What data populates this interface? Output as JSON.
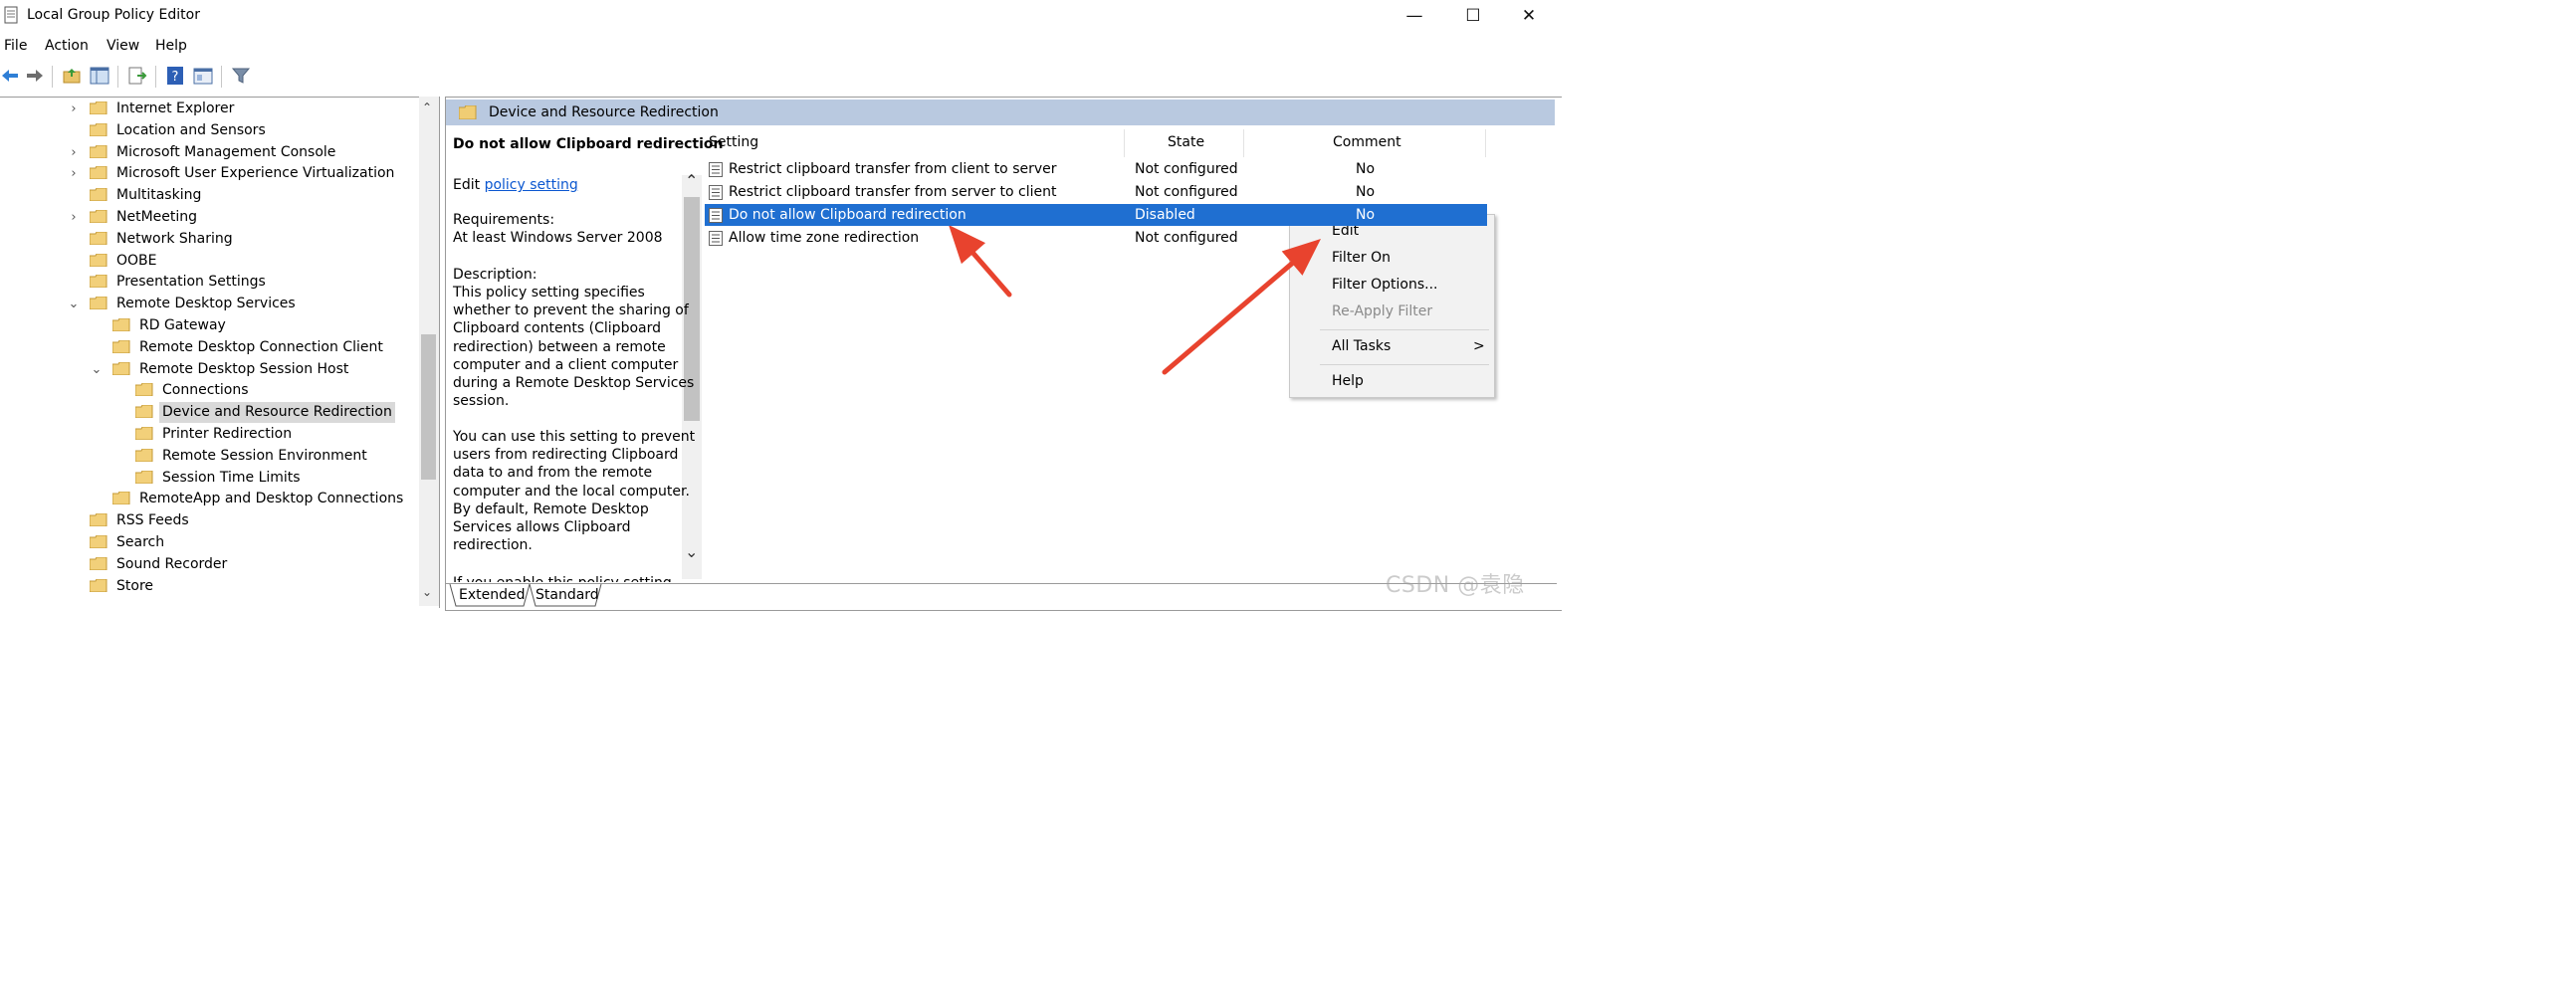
{
  "window": {
    "title": "Local Group Policy Editor",
    "controls": {
      "minimize": "—",
      "maximize": "☐",
      "close": "✕"
    }
  },
  "menu": [
    "File",
    "Action",
    "View",
    "Help"
  ],
  "toolbar": {
    "icons": [
      "back-icon",
      "forward-icon",
      "up-folder-icon",
      "show-hide-tree-icon",
      "export-list-icon",
      "help-icon",
      "properties-icon",
      "filter-icon"
    ]
  },
  "tree": {
    "items": [
      {
        "label": "Internet Explorer",
        "expander": ">"
      },
      {
        "label": "Location and Sensors",
        "expander": ""
      },
      {
        "label": "Microsoft Management Console",
        "expander": ">"
      },
      {
        "label": "Microsoft User Experience Virtualization",
        "expander": ">"
      },
      {
        "label": "Multitasking",
        "expander": ""
      },
      {
        "label": "NetMeeting",
        "expander": ">"
      },
      {
        "label": "Network Sharing",
        "expander": ""
      },
      {
        "label": "OOBE",
        "expander": ""
      },
      {
        "label": "Presentation Settings",
        "expander": ""
      },
      {
        "label": "Remote Desktop Services",
        "expander": "v"
      },
      {
        "label": "RD Gateway",
        "expander": ""
      },
      {
        "label": "Remote Desktop Connection Client",
        "expander": ""
      },
      {
        "label": "Remote Desktop Session Host",
        "expander": "v"
      },
      {
        "label": "Connections",
        "expander": ""
      },
      {
        "label": "Device and Resource Redirection",
        "expander": "",
        "selected": true
      },
      {
        "label": "Printer Redirection",
        "expander": ""
      },
      {
        "label": "Remote Session Environment",
        "expander": ""
      },
      {
        "label": "Session Time Limits",
        "expander": ""
      },
      {
        "label": "RemoteApp and Desktop Connections",
        "expander": ""
      },
      {
        "label": "RSS Feeds",
        "expander": ""
      },
      {
        "label": "Search",
        "expander": ""
      },
      {
        "label": "Sound Recorder",
        "expander": ""
      },
      {
        "label": "Store",
        "expander": ""
      }
    ]
  },
  "pane": {
    "header": "Device and Resource Redirection",
    "desc": {
      "title": "Do not allow Clipboard redirection",
      "edit_prefix": "Edit ",
      "edit_link": "policy setting ",
      "req_label": "Requirements:",
      "req_value": "At least Windows Server 2008",
      "desc_label": "Description:",
      "desc_lines": [
        "This policy setting specifies",
        "whether to prevent the sharing of",
        "Clipboard contents (Clipboard",
        "redirection) between a remote",
        "computer and a client computer",
        "during a Remote Desktop Services",
        "session."
      ],
      "more_lines": [
        "You can use this setting to prevent",
        "users from redirecting Clipboard",
        "data to and from the remote",
        "computer and the local computer.",
        "By default, Remote Desktop",
        "Services allows Clipboard",
        "redirection."
      ],
      "cut_line": "If you enable this policy setting"
    },
    "columns": {
      "setting": "Setting",
      "state": "State",
      "comment": "Comment"
    },
    "rows": [
      {
        "setting": "Restrict clipboard transfer from client to server",
        "state": "Not configured",
        "comment": "No"
      },
      {
        "setting": "Restrict clipboard transfer from server to client",
        "state": "Not configured",
        "comment": "No"
      },
      {
        "setting": "Do not allow Clipboard redirection",
        "state": "Disabled",
        "comment": "No",
        "selected": true
      },
      {
        "setting": "Allow time zone redirection",
        "state": "Not configured",
        "comment": ""
      }
    ],
    "tabs": [
      "Extended",
      "Standard"
    ]
  },
  "context_menu": {
    "items": [
      "Edit",
      "Filter On",
      "Filter Options...",
      "Re-Apply Filter",
      "All Tasks",
      "Help"
    ],
    "submenu_arrow": ">"
  },
  "annotation_color": "#e8432e",
  "selection_color": "#1f6fd1",
  "watermark": "CSDN @袁隐"
}
